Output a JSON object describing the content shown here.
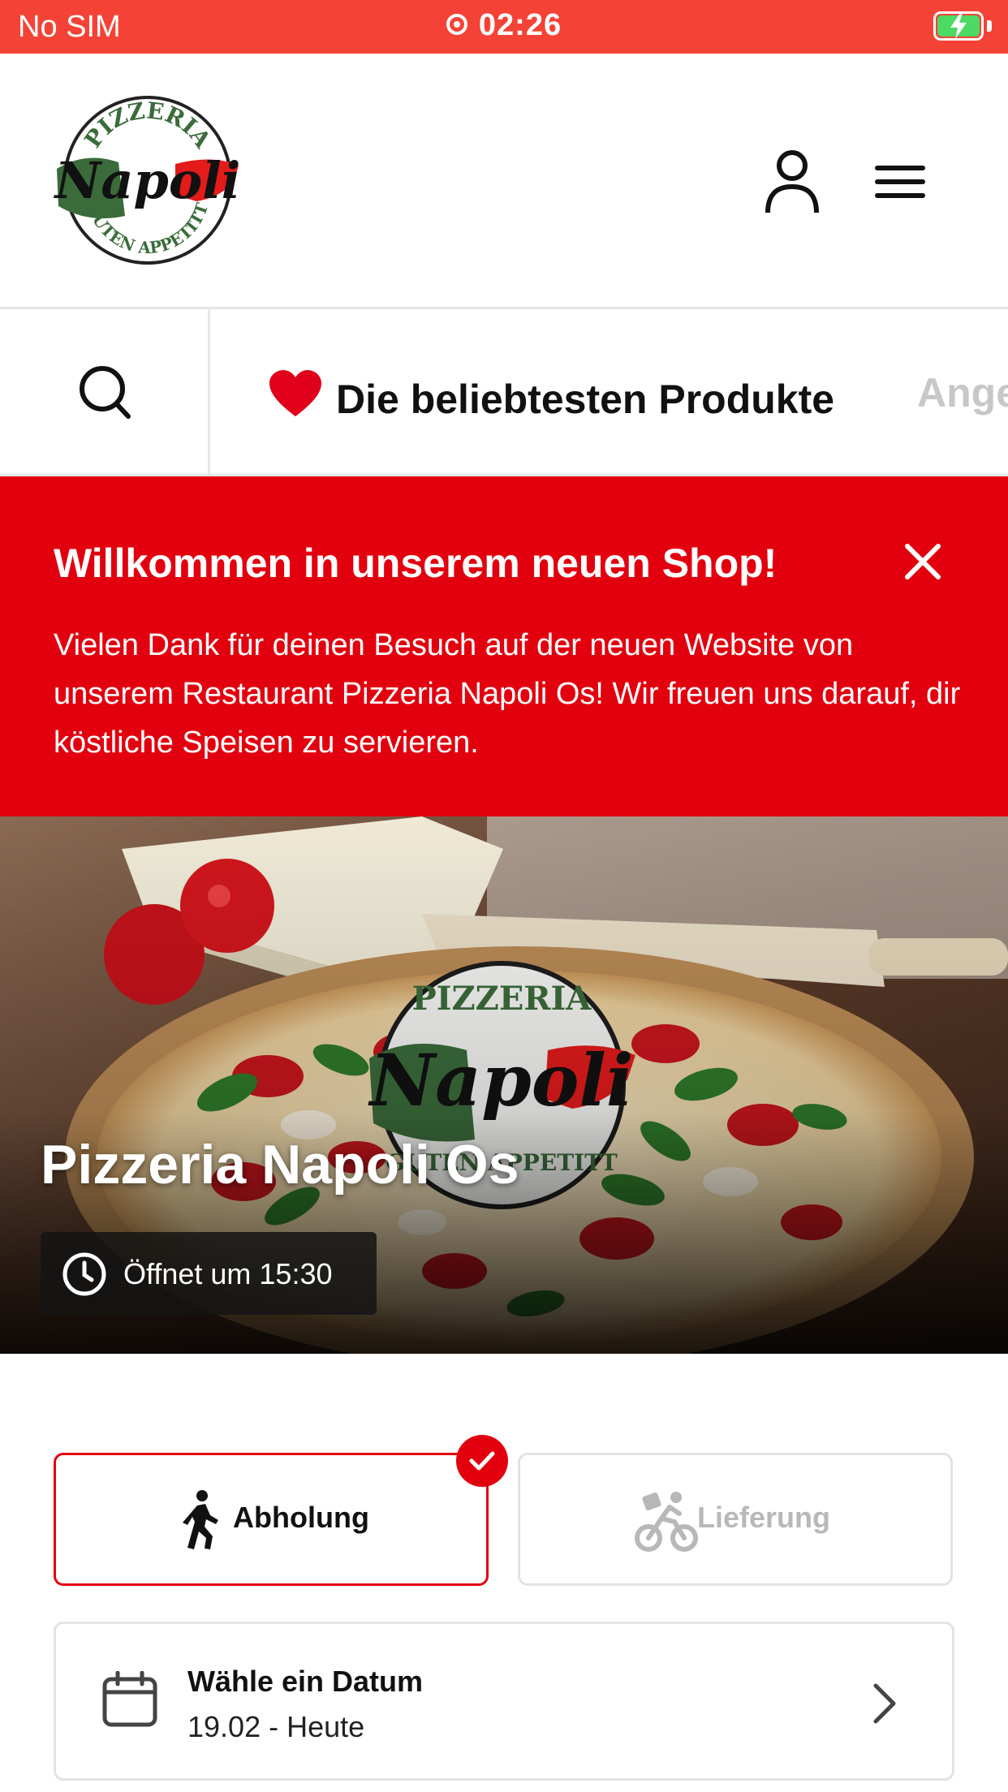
{
  "status_bar": {
    "carrier": "No SIM",
    "time": "02:26",
    "battery_state": "charging"
  },
  "header": {
    "logo": {
      "top_text": "PIZZERIA",
      "name": "Napoli",
      "bottom_text": "GUTEN APPETITT"
    },
    "account_icon": "user-icon",
    "menu_icon": "hamburger-menu-icon"
  },
  "categories": {
    "search_icon": "search-icon",
    "active": "Die beliebtesten Produkte",
    "active_icon": "heart-emoji",
    "next": "Angebote"
  },
  "banner": {
    "title": "Willkommen in unserem neuen Shop!",
    "text": "Vielen Dank für deinen Besuch auf der neuen Website von unserem Restaurant Pizzeria Napoli Os! Wir freuen uns darauf, dir köstliche Speisen zu servieren.",
    "background": "#e2000f"
  },
  "hero": {
    "restaurant_name": "Pizzeria Napoli Os",
    "opening_status": "Öffnet um 15:30"
  },
  "order_type": {
    "pickup_label": "Abholung",
    "delivery_label": "Lieferung",
    "selected": "pickup"
  },
  "date_picker": {
    "label": "Wähle ein Datum",
    "value": "19.02 - Heute"
  },
  "colors": {
    "status_bar": "#f44336",
    "accent": "#e2000f"
  }
}
